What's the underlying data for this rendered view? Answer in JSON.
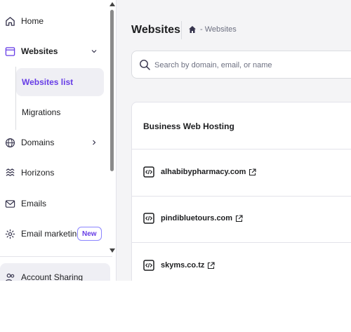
{
  "sidebar": {
    "items": [
      {
        "label": "Home",
        "icon": "home-icon"
      },
      {
        "label": "Websites",
        "icon": "browser-icon",
        "expanded": true
      },
      {
        "label": "Domains",
        "icon": "globe-icon"
      },
      {
        "label": "Horizons",
        "icon": "horizons-icon"
      },
      {
        "label": "Emails",
        "icon": "mail-icon"
      },
      {
        "label": "Email marketing",
        "icon": "marketing-icon",
        "badge": "New"
      },
      {
        "label": "Account Sharing",
        "icon": "users-icon"
      }
    ],
    "websites_sub": [
      {
        "label": "Websites list",
        "active": true
      },
      {
        "label": "Migrations",
        "active": false
      }
    ]
  },
  "header": {
    "title": "Websites",
    "breadcrumb": "- Websites"
  },
  "search": {
    "placeholder": "Search by domain, email, or name",
    "value": ""
  },
  "hosting": {
    "title": "Business Web Hosting",
    "sites": [
      {
        "domain": "alhabibypharmacy.com"
      },
      {
        "domain": "pindibluetours.com"
      },
      {
        "domain": "skyms.co.tz"
      }
    ]
  },
  "colors": {
    "accent": "#673de6",
    "main_bg": "#f4f4f6",
    "border": "#e3e3ea",
    "text": "#1d1e20",
    "muted": "#6d7081"
  }
}
